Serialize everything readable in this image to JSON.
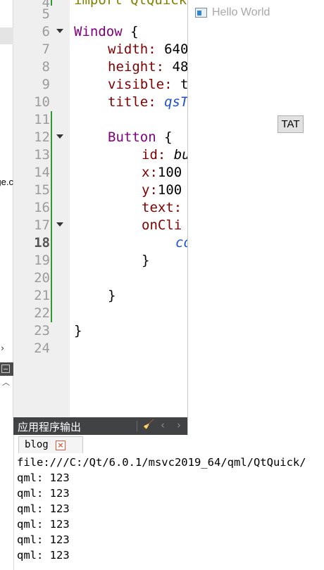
{
  "sidebar": {
    "partial_text": "ge.c",
    "expand_glyph": "›",
    "collapse_glyph": "︿"
  },
  "editor": {
    "lines": [
      {
        "num": "4",
        "text": "import QtQuick"
      },
      {
        "num": "5",
        "text": ""
      },
      {
        "num": "6",
        "text": "Window {"
      },
      {
        "num": "7",
        "text": "    width: 640"
      },
      {
        "num": "8",
        "text": "    height: 48"
      },
      {
        "num": "9",
        "text": "    visible: t"
      },
      {
        "num": "10",
        "text": "    title: qsT"
      },
      {
        "num": "11",
        "text": ""
      },
      {
        "num": "12",
        "text": "    Button {"
      },
      {
        "num": "13",
        "text": "        id: bu"
      },
      {
        "num": "14",
        "text": "        x:100"
      },
      {
        "num": "15",
        "text": "        y:100"
      },
      {
        "num": "16",
        "text": "        text:"
      },
      {
        "num": "17",
        "text": "        onCli"
      },
      {
        "num": "18",
        "text": "            co"
      },
      {
        "num": "19",
        "text": "        }"
      },
      {
        "num": "20",
        "text": ""
      },
      {
        "num": "21",
        "text": "    }"
      },
      {
        "num": "22",
        "text": ""
      },
      {
        "num": "23",
        "text": "}"
      },
      {
        "num": "24",
        "text": ""
      }
    ],
    "current_line": "18",
    "tokens": {
      "import_partial": "import QtQuick",
      "window_kw": "Window",
      "window_brace": " {",
      "width_prop": "width:",
      "width_val": " 640",
      "height_prop": "height:",
      "height_val": " 48",
      "visible_prop": "visible:",
      "visible_val": " t",
      "title_prop": "title:",
      "title_val": "qsT",
      "button_kw": "Button",
      "button_brace": " {",
      "id_prop": "id:",
      "id_val": "bu",
      "x_prop": "x:",
      "x_val": "100",
      "y_prop": "y:",
      "y_val": "100",
      "text_prop": "text:",
      "onclick_prop": "onCli",
      "call_val": "co",
      "brace_close": "}"
    }
  },
  "preview_window": {
    "title": "Hello World",
    "button_label": "TAT"
  },
  "output": {
    "panel_title": "应用程序输出",
    "clear_glyph": "🧹",
    "prev_glyph": "‹",
    "next_glyph": "›",
    "tab_label": "blog",
    "tab_close": "×",
    "lines": [
      "file:///C:/Qt/6.0.1/msvc2019_64/qml/QtQuick/",
      "qml: 123",
      "qml: 123",
      "qml: 123",
      "qml: 123",
      "qml: 123",
      "qml: 123"
    ]
  },
  "colors": {
    "keyword": "#800080",
    "property": "#800000",
    "italic_value": "#1a4fd6",
    "modified_bar": "#2e9a2e",
    "output_header": "#404244"
  }
}
